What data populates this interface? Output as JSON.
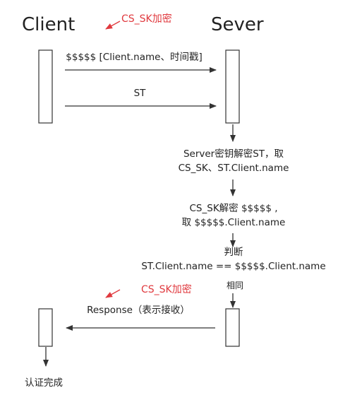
{
  "participants": {
    "client": "Client",
    "server": "Sever"
  },
  "annotations": {
    "encrypt_top": "CS_SK加密",
    "encrypt_bottom": "CS_SK加密"
  },
  "messages": {
    "m1": "$$$$$ [Client.name、时间戳]",
    "m2": "ST",
    "response": "Response（表示接收）"
  },
  "server_steps": {
    "step1_line1": "Server密钥解密ST，取",
    "step1_line2": "CS_SK、ST.Client.name",
    "step2_line1": "CS_SK解密 $$$$$ ,",
    "step2_line2": "取 $$$$$.Client.name",
    "step3_top": "判断",
    "step3_mid": "ST.Client.name == $$$$$.Client.name",
    "step3_bottom": "相同"
  },
  "client_final": "认证完成",
  "colors": {
    "annotation": "#e0393e",
    "line": "#333333"
  }
}
